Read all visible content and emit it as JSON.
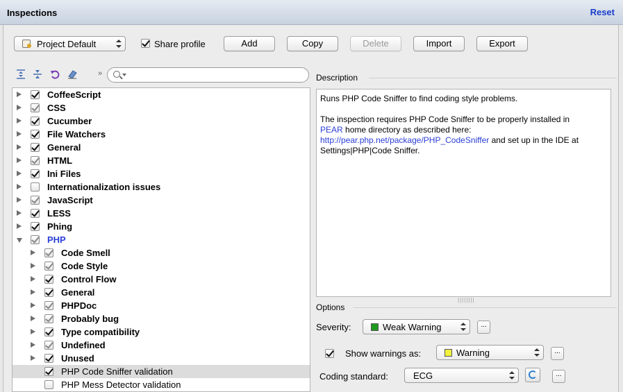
{
  "window": {
    "title": "Inspections",
    "reset_label": "Reset"
  },
  "toolbar": {
    "profile": "Project Default",
    "share_profile_label": "Share profile",
    "share_profile_checked": true,
    "buttons": {
      "add": "Add",
      "copy": "Copy",
      "delete": "Delete",
      "import": "Import",
      "export": "Export"
    },
    "overflow_chevron": "»"
  },
  "tree": {
    "items": [
      {
        "label": "CoffeeScript",
        "depth": 0,
        "expanded": false,
        "checked": true,
        "partial": false
      },
      {
        "label": "CSS",
        "depth": 0,
        "expanded": false,
        "checked": true,
        "partial": true
      },
      {
        "label": "Cucumber",
        "depth": 0,
        "expanded": false,
        "checked": true,
        "partial": false
      },
      {
        "label": "File Watchers",
        "depth": 0,
        "expanded": false,
        "checked": true,
        "partial": false
      },
      {
        "label": "General",
        "depth": 0,
        "expanded": false,
        "checked": true,
        "partial": false
      },
      {
        "label": "HTML",
        "depth": 0,
        "expanded": false,
        "checked": true,
        "partial": true
      },
      {
        "label": "Ini Files",
        "depth": 0,
        "expanded": false,
        "checked": true,
        "partial": false
      },
      {
        "label": "Internationalization issues",
        "depth": 0,
        "expanded": false,
        "checked": false,
        "partial": false
      },
      {
        "label": "JavaScript",
        "depth": 0,
        "expanded": false,
        "checked": true,
        "partial": true
      },
      {
        "label": "LESS",
        "depth": 0,
        "expanded": false,
        "checked": true,
        "partial": false
      },
      {
        "label": "Phing",
        "depth": 0,
        "expanded": false,
        "checked": true,
        "partial": false
      },
      {
        "label": "PHP",
        "depth": 0,
        "expanded": true,
        "checked": true,
        "partial": true
      },
      {
        "label": "Code Smell",
        "depth": 1,
        "expanded": false,
        "checked": true,
        "partial": true
      },
      {
        "label": "Code Style",
        "depth": 1,
        "expanded": false,
        "checked": true,
        "partial": true
      },
      {
        "label": "Control Flow",
        "depth": 1,
        "expanded": false,
        "checked": true,
        "partial": false
      },
      {
        "label": "General",
        "depth": 1,
        "expanded": false,
        "checked": true,
        "partial": false
      },
      {
        "label": "PHPDoc",
        "depth": 1,
        "expanded": false,
        "checked": true,
        "partial": true
      },
      {
        "label": "Probably bug",
        "depth": 1,
        "expanded": false,
        "checked": true,
        "partial": true
      },
      {
        "label": "Type compatibility",
        "depth": 1,
        "expanded": false,
        "checked": true,
        "partial": false
      },
      {
        "label": "Undefined",
        "depth": 1,
        "expanded": false,
        "checked": true,
        "partial": true
      },
      {
        "label": "Unused",
        "depth": 1,
        "expanded": false,
        "checked": true,
        "partial": false
      },
      {
        "label": "PHP Code Sniffer validation",
        "depth": 1,
        "leaf": true,
        "checked": true,
        "partial": false,
        "selected": true
      },
      {
        "label": "PHP Mess Detector validation",
        "depth": 1,
        "leaf": true,
        "checked": false,
        "partial": false
      }
    ]
  },
  "description": {
    "heading": "Description",
    "line1": "Runs PHP Code Sniffer to find coding style problems.",
    "line2_a": "The inspection requires PHP Code Sniffer to be properly installed in",
    "pear_link": "PEAR",
    "line2_b": " home directory as described here:",
    "url_link": "http://pear.php.net/package/PHP_CodeSniffer",
    "line2_c": " and set up in the IDE at Settings|PHP|Code Sniffer."
  },
  "options": {
    "heading": "Options",
    "severity_label": "Severity:",
    "severity_value": "Weak Warning",
    "severity_color": "#1f9a1f",
    "show_warnings_label": "Show warnings as:",
    "show_warnings_checked": true,
    "show_warnings_value": "Warning",
    "show_warnings_color": "#f3f23c",
    "coding_standard_label": "Coding standard:",
    "coding_standard_value": "ECG",
    "more_label": "..."
  }
}
